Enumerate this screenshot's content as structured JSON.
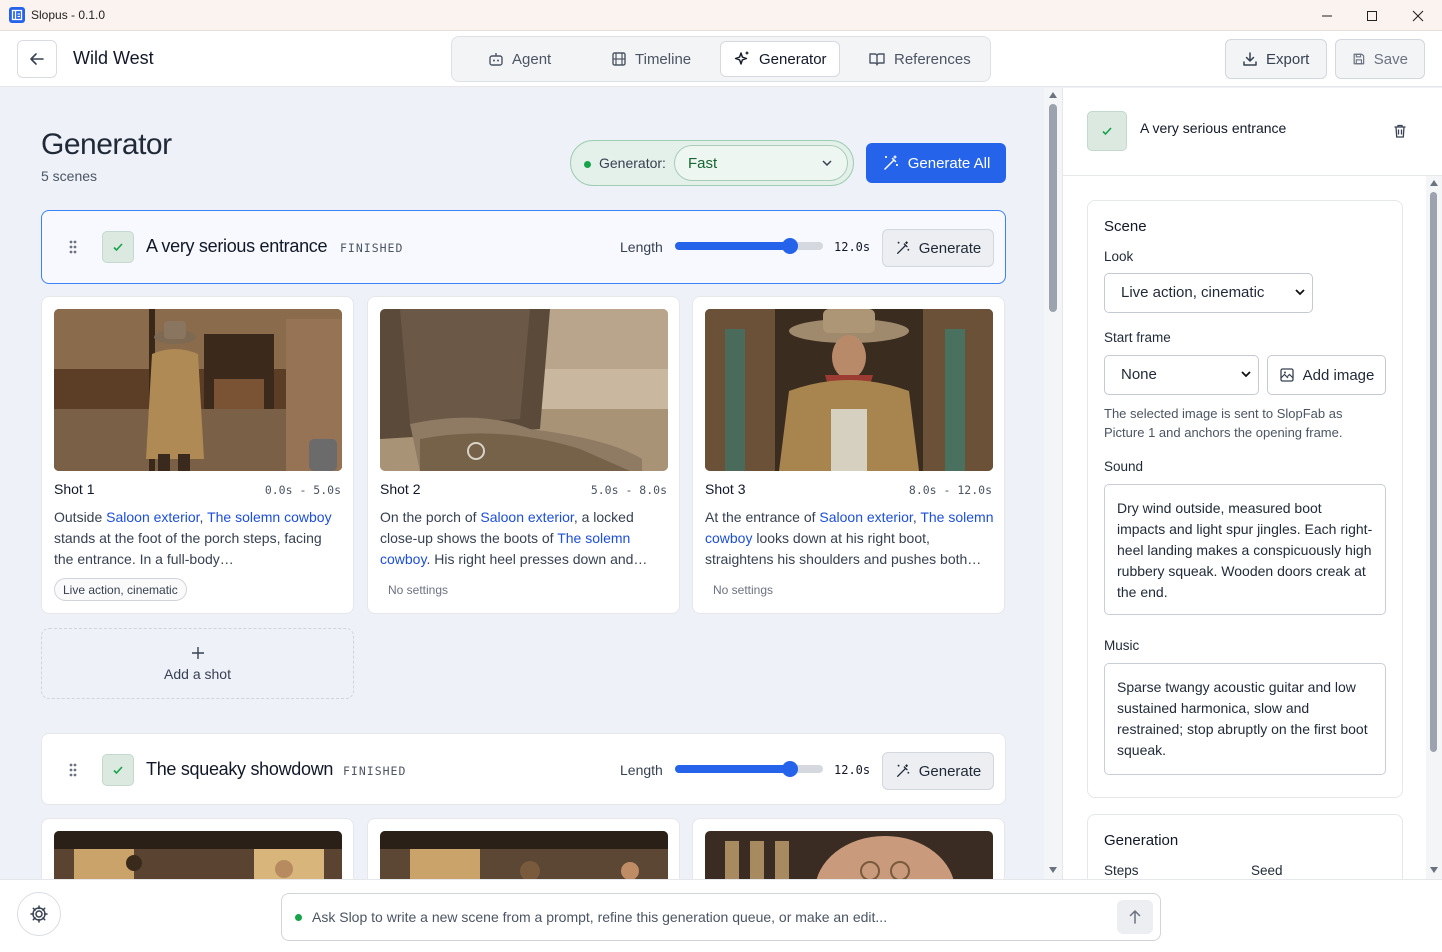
{
  "window": {
    "title": "Slopus - 0.1.0"
  },
  "header": {
    "project_title": "Wild West",
    "tabs": [
      {
        "label": "Agent",
        "icon": "robot-icon",
        "active": false
      },
      {
        "label": "Timeline",
        "icon": "film-icon",
        "active": false
      },
      {
        "label": "Generator",
        "icon": "sparkles-icon",
        "active": true
      },
      {
        "label": "References",
        "icon": "book-open-icon",
        "active": false
      }
    ],
    "export_label": "Export",
    "save_label": "Save"
  },
  "main": {
    "title": "Generator",
    "scene_count": "5 scenes",
    "generator_label": "Generator:",
    "generator_value": "Fast",
    "generate_all_label": "Generate All",
    "length_label": "Length",
    "generate_label": "Generate",
    "add_shot_label": "Add a shot",
    "scenes": [
      {
        "name": "A very serious entrance",
        "status": "FINISHED",
        "length_value": "12.0s",
        "length_fraction": 0.78,
        "shots": [
          {
            "title": "Shot 1",
            "time": "0.0s - 5.0s",
            "desc": [
              [
                "Outside ",
                false
              ],
              [
                "Saloon exterior",
                true
              ],
              [
                ", ",
                false
              ],
              [
                "The solemn cowboy",
                true
              ],
              [
                " stands at the foot of the porch steps, facing the entrance. In a full-body…",
                false
              ]
            ],
            "tag": "Live action, cinematic"
          },
          {
            "title": "Shot 2",
            "time": "5.0s - 8.0s",
            "desc": [
              [
                "On the porch of ",
                false
              ],
              [
                "Saloon exterior",
                true
              ],
              [
                ", a locked close-up shows the boots of ",
                false
              ],
              [
                "The solemn cowboy",
                true
              ],
              [
                ". His right heel presses down and…",
                false
              ]
            ],
            "settings": "No settings"
          },
          {
            "title": "Shot 3",
            "time": "8.0s - 12.0s",
            "desc": [
              [
                "At the entrance of ",
                false
              ],
              [
                "Saloon exterior",
                true
              ],
              [
                ", ",
                false
              ],
              [
                "The solemn cowboy",
                true
              ],
              [
                " looks down at his right boot, straightens his shoulders and pushes both…",
                false
              ]
            ],
            "settings": "No settings"
          }
        ]
      },
      {
        "name": "The squeaky showdown",
        "status": "FINISHED",
        "length_value": "12.0s",
        "length_fraction": 0.78
      }
    ]
  },
  "panel": {
    "scene_title": "A very serious entrance",
    "scene_section": "Scene",
    "look_label": "Look",
    "look_value": "Live action, cinematic",
    "start_frame_label": "Start frame",
    "start_frame_value": "None",
    "add_image_label": "Add image",
    "help_text": "The selected image is sent to SlopFab as Picture 1 and anchors the opening frame.",
    "sound_label": "Sound",
    "sound_text": "Dry wind outside, measured boot impacts and light spur jingles. Each right-heel landing makes a conspicuously high rubbery squeak. Wooden doors creak at the end.",
    "music_label": "Music",
    "music_text": "Sparse twangy acoustic guitar and low sustained harmonica, slow and restrained; stop abruptly on the first boot squeak.",
    "generation_section": "Generation",
    "steps_label": "Steps",
    "seed_label": "Seed"
  },
  "footer": {
    "chat_placeholder": "Ask Slop to write a new scene from a prompt, refine this generation queue, or make an edit..."
  },
  "colors": {
    "accent": "#2563eb",
    "ready_green": "#16a34a",
    "entity_link": "#1d4ed8"
  }
}
